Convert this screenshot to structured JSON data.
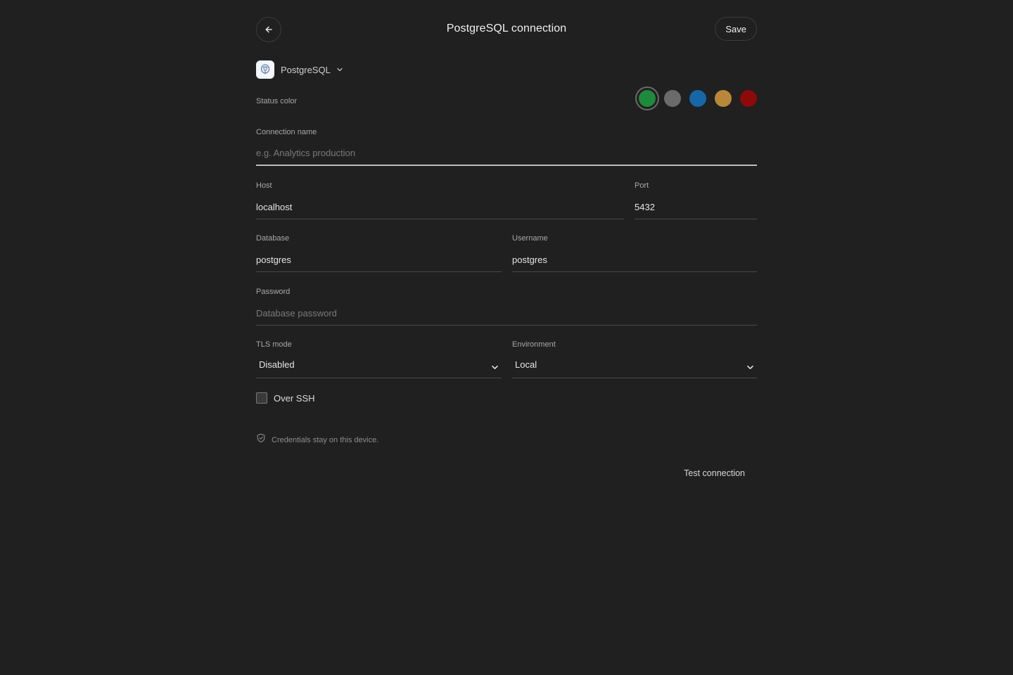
{
  "header": {
    "title": "PostgreSQL connection",
    "save_label": "Save"
  },
  "driver": {
    "label": "PostgreSQL"
  },
  "status_color": {
    "label": "Status color",
    "options": [
      "#1e8a3c",
      "#6b6b6b",
      "#1667a8",
      "#b8873a",
      "#8c0a0a"
    ],
    "selected_index": 0
  },
  "fields": {
    "connection_name": {
      "label": "Connection name",
      "value": "",
      "placeholder": "e.g. Analytics production"
    },
    "host": {
      "label": "Host",
      "value": "localhost",
      "placeholder": ""
    },
    "port": {
      "label": "Port",
      "value": "5432",
      "placeholder": ""
    },
    "database": {
      "label": "Database",
      "value": "postgres",
      "placeholder": ""
    },
    "username": {
      "label": "Username",
      "value": "postgres",
      "placeholder": ""
    },
    "password": {
      "label": "Password",
      "value": "",
      "placeholder": "Database password"
    },
    "tls_mode": {
      "label": "TLS mode",
      "value": "Disabled"
    },
    "environment": {
      "label": "Environment",
      "value": "Local"
    }
  },
  "over_ssh": {
    "label": "Over SSH",
    "checked": false
  },
  "note": {
    "text": "Credentials stay on this device."
  },
  "actions": {
    "test_label": "Test connection"
  }
}
